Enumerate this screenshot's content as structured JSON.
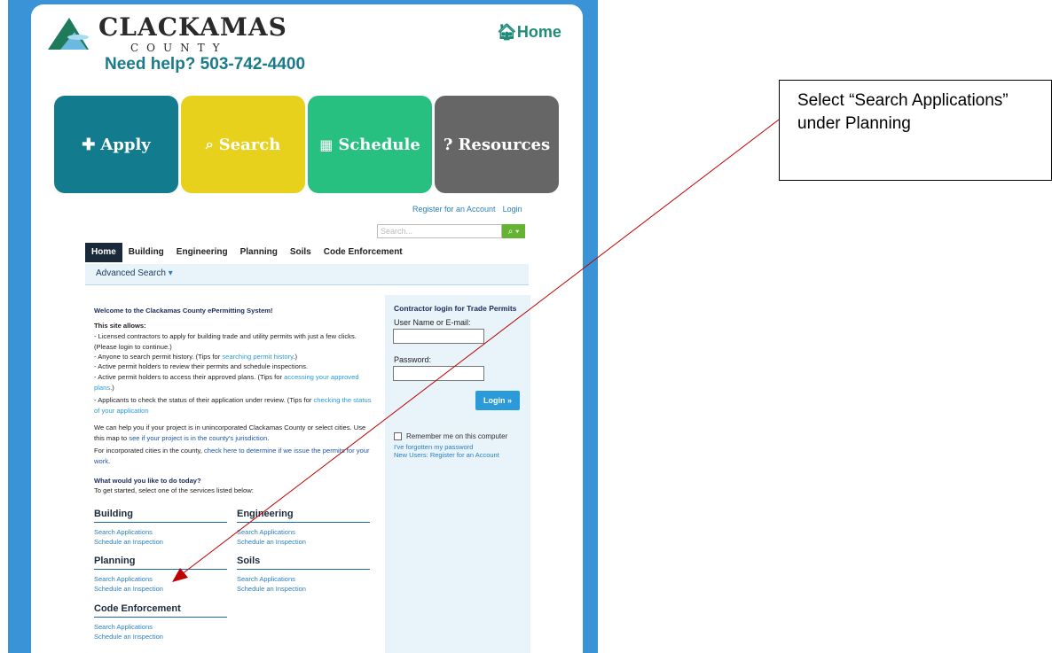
{
  "header": {
    "logo_name": "CLACKAMAS",
    "logo_sub": "COUNTY",
    "help_text": "Need help? 503-742-4400",
    "home_label": "Home"
  },
  "tiles": [
    {
      "label": "Apply",
      "icon": "plus-icon",
      "glyph": "✚",
      "color": "#137b8e"
    },
    {
      "label": "Search",
      "icon": "search-icon",
      "glyph": "🔍",
      "color": "#e7d11d"
    },
    {
      "label": "Schedule",
      "icon": "calendar-icon",
      "glyph": "📅",
      "color": "#28c081"
    },
    {
      "label": "Resources",
      "icon": "question-icon",
      "glyph": "?",
      "color": "#666666"
    }
  ],
  "top_links": {
    "register": "Register for an Account",
    "login": "Login"
  },
  "search": {
    "placeholder": "Search..."
  },
  "nav": {
    "tabs": [
      "Home",
      "Building",
      "Engineering",
      "Planning",
      "Soils",
      "Code Enforcement"
    ],
    "active": "Home",
    "advanced_search": "Advanced Search"
  },
  "welcome": {
    "title": "Welcome to the Clackamas County ePermitting System!",
    "allows": "This site allows:",
    "line1": "- Licensed contractors to apply for building trade and utility permits with just a few clicks. (Please login to continue.)",
    "line2_pre": "- Anyone to search permit history. (Tips for ",
    "line2_link": "searching permit history",
    "line2_post": ".)",
    "line3": "- Active permit holders to review their permits and schedule inspections.",
    "line4_pre": "- Active permit holders to access their approved plans. (Tips for ",
    "line4_link": "accessing your approved plans",
    "line4_post": ".)",
    "line5_pre": "- Applicants to check the status of their application under review. (Tips for ",
    "line5_link": "checking the status of your application",
    "map_pre": "We can help you if your project is in unincorporated Clackamas County or select cities. Use this map to ",
    "map_link": "see if your project is in the county's jurisdiction",
    "map_post": ".",
    "cities_pre": "For incorporated cities in the county, ",
    "cities_link": "check here to determine if we issue the permits for your work",
    "cities_post": ".",
    "todo_title": "What would you like to do today?",
    "todo_sub": "To get started, select one of the services listed below:"
  },
  "services": [
    {
      "name": "Building",
      "links": [
        "Search Applications",
        "Schedule an Inspection"
      ]
    },
    {
      "name": "Engineering",
      "links": [
        "Search Applications",
        "Schedule an Inspection"
      ]
    },
    {
      "name": "Planning",
      "links": [
        "Search Applications",
        "Schedule an Inspection"
      ]
    },
    {
      "name": "Soils",
      "links": [
        "Search Applications",
        "Schedule an Inspection"
      ]
    },
    {
      "name": "Code Enforcement",
      "links": [
        "Search Applications",
        "Schedule an Inspection"
      ]
    }
  ],
  "login_panel": {
    "title": "Contractor login for Trade Permits",
    "user_label": "User Name or E-mail:",
    "password_label": "Password:",
    "login_button": "Login »",
    "remember": "Remember me on this computer",
    "forgot": "I've forgotten my password",
    "new_users": "New Users: Register for an Account"
  },
  "callout": {
    "text": "Select “Search Applications” under Planning"
  },
  "colors": {
    "frame": "#3a93d6",
    "arrow": "#c00000"
  }
}
